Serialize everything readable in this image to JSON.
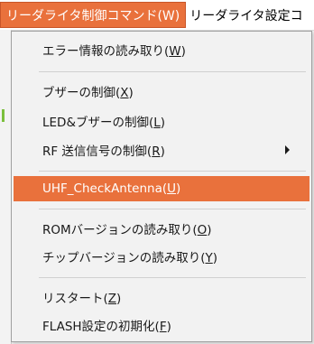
{
  "menubar": {
    "items": [
      {
        "label": "リーダライタ制御コマンド(W)"
      },
      {
        "label": "リーダライタ設定コ"
      }
    ]
  },
  "dropdown": {
    "items": [
      {
        "text": "エラー情報の読み取り(",
        "key": "W",
        "close": ")"
      },
      {
        "text": "ブザーの制御(",
        "key": "X",
        "close": ")"
      },
      {
        "text": "LED&ブザーの制御(",
        "key": "L",
        "close": ")"
      },
      {
        "text": "RF 送信信号の制御(",
        "key": "R",
        "close": ")",
        "submenu_icon": "chevron-right-icon"
      },
      {
        "text": "UHF_CheckAntenna(",
        "key": "U",
        "close": ")"
      },
      {
        "text": "ROMバージョンの読み取り(",
        "key": "O",
        "close": ")"
      },
      {
        "text": "チップバージョンの読み取り(",
        "key": "Y",
        "close": ")"
      },
      {
        "text": "リスタート(",
        "key": "Z",
        "close": ")"
      },
      {
        "text": "FLASH設定の初期化(",
        "key": "F",
        "close": ")"
      }
    ]
  },
  "colors": {
    "accent": "#e9713c",
    "menu_background": "#f2f2f2",
    "separator": "#d0d0d0"
  }
}
